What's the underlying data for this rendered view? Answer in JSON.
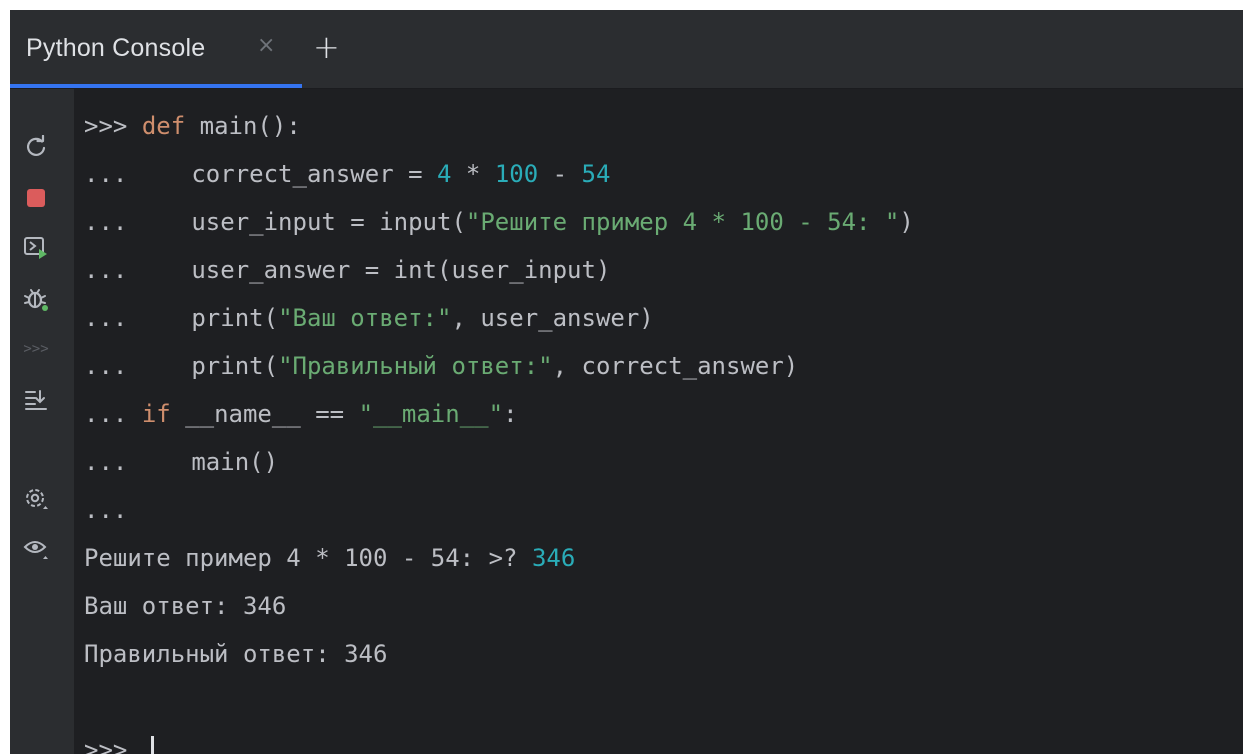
{
  "tabs": {
    "active_label": "Python Console",
    "close_glyph": "×",
    "new_tab_glyph": "+"
  },
  "toolbar_icons": [
    {
      "name": "rerun-icon"
    },
    {
      "name": "stop-icon",
      "color": "#db5c5c"
    },
    {
      "name": "execute-current-statement-icon"
    },
    {
      "name": "attach-debugger-icon"
    },
    {
      "name": "history-icon"
    },
    {
      "name": "scroll-to-end-icon"
    },
    {
      "name": "settings-icon"
    },
    {
      "name": "show-variables-icon"
    }
  ],
  "console": {
    "prompt": ">>>",
    "continuation": "...",
    "l1": {
      "kw": "def",
      "rest": " main():"
    },
    "l2": {
      "a": "correct_answer = ",
      "n1": "4",
      "b": " * ",
      "n2": "100",
      "c": " - ",
      "n3": "54"
    },
    "l3": {
      "a": "user_input = input(",
      "s": "\"Решите пример 4 * 100 - 54: \"",
      "b": ")"
    },
    "l4": {
      "a": "user_answer = int(user_input)"
    },
    "l5": {
      "a": "print(",
      "s": "\"Ваш ответ:\"",
      "b": ", user_answer)"
    },
    "l6": {
      "a": "print(",
      "s": "\"Правильный ответ:\"",
      "b": ", correct_answer)"
    },
    "l7": {
      "kw": "if",
      "a": " __name__ == ",
      "s": "\"__main__\"",
      "b": ":"
    },
    "l8": {
      "a": "main()"
    },
    "out1": {
      "a": "Решите пример 4 * 100 - 54: >? ",
      "v": "346"
    },
    "out2": "Ваш ответ: 346",
    "out3": "Правильный ответ: 346"
  },
  "colors": {
    "background": "#1e1f22",
    "keyword": "#cf8e6d",
    "number": "#2aacb8",
    "string": "#6aab73",
    "text": "#bcbec4",
    "accent": "#3574f0"
  }
}
